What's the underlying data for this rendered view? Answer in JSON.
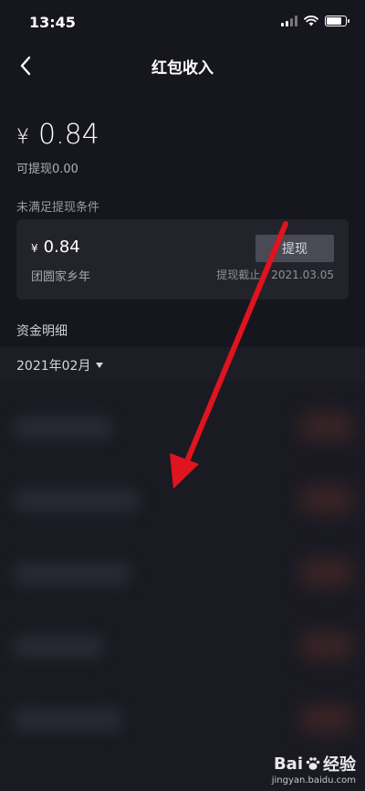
{
  "status_bar": {
    "time": "13:45",
    "battery_level": 0.8
  },
  "nav": {
    "title": "红包收入",
    "back_icon": "chevron-left-icon"
  },
  "balance": {
    "currency": "¥",
    "amount": "0.84",
    "withdrawable": "可提现0.00"
  },
  "condition": {
    "label": "未满足提现条件",
    "card": {
      "currency": "¥",
      "amount": "0.84",
      "name": "团圆家乡年",
      "button_label": "提现",
      "deadline": "提现截止：2021.03.05"
    }
  },
  "details": {
    "title": "资金明细",
    "month": "2021年02月"
  },
  "colors": {
    "background": "#16161e",
    "card": "#23232c",
    "arrow": "#e0141e"
  },
  "watermark": {
    "brand_left": "Bai",
    "brand_right": "经验",
    "url": "jingyan.baidu.com"
  }
}
